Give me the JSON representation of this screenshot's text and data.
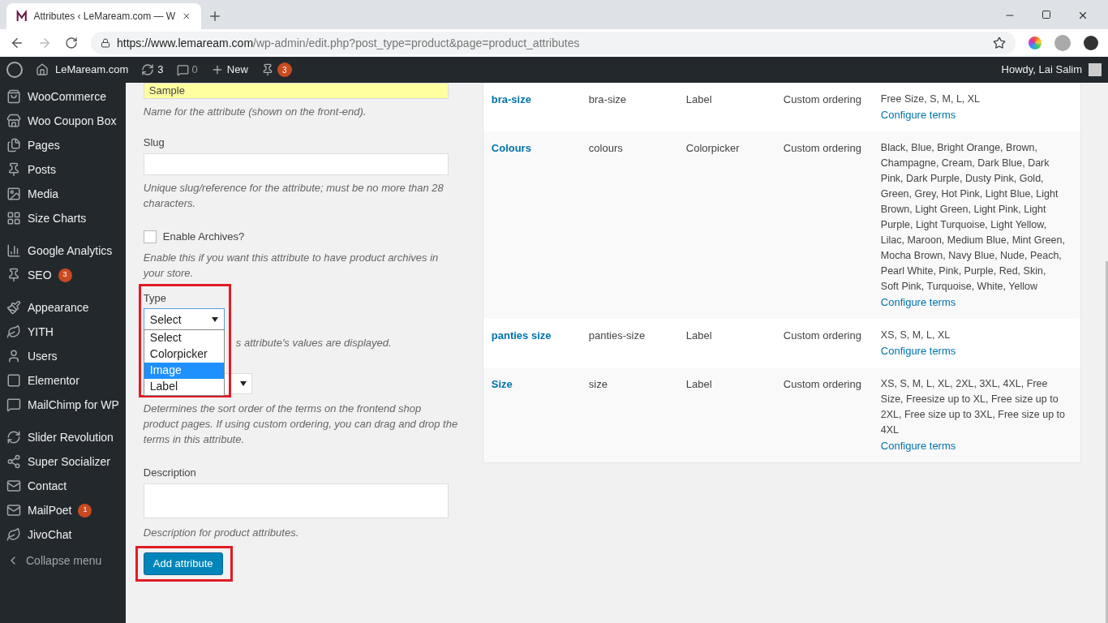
{
  "browser": {
    "tab_title": "Attributes ‹ LeMaream.com — W",
    "url_host": "https://www.lemaream.com",
    "url_path": "/wp-admin/edit.php?post_type=product&page=product_attributes"
  },
  "admin_bar": {
    "site": "LeMaream.com",
    "updates": "3",
    "comments": "0",
    "new": "New",
    "seo_badge": "3",
    "greeting": "Howdy, Lai Salim"
  },
  "sidebar": {
    "groups": [
      [
        {
          "label": "WooCommerce"
        },
        {
          "label": "Woo Coupon Box"
        },
        {
          "label": "Pages"
        },
        {
          "label": "Posts"
        },
        {
          "label": "Media"
        },
        {
          "label": "Size Charts"
        }
      ],
      [
        {
          "label": "Google Analytics"
        },
        {
          "label": "SEO",
          "badge": "3"
        }
      ],
      [
        {
          "label": "Appearance"
        },
        {
          "label": "YITH"
        },
        {
          "label": "Users"
        },
        {
          "label": "Elementor"
        },
        {
          "label": "MailChimp for WP"
        }
      ],
      [
        {
          "label": "Slider Revolution"
        },
        {
          "label": "Super Socializer"
        },
        {
          "label": "Contact"
        },
        {
          "label": "MailPoet",
          "badge": "1"
        },
        {
          "label": "JivoChat"
        }
      ]
    ],
    "collapse": "Collapse menu"
  },
  "form": {
    "name_value": "Sample",
    "name_help": "Name for the attribute (shown on the front-end).",
    "slug_label": "Slug",
    "slug_help": "Unique slug/reference for the attribute; must be no more than 28 characters.",
    "archives_label": "Enable Archives?",
    "archives_checked": false,
    "archives_help": "Enable this if you want this attribute to have product archives in your store.",
    "type_label": "Type",
    "type_value": "Select",
    "type_options": [
      {
        "label": "Select",
        "selected": false
      },
      {
        "label": "Colorpicker",
        "selected": false
      },
      {
        "label": "Image",
        "selected": true
      },
      {
        "label": "Label",
        "selected": false
      }
    ],
    "type_help_fragment": "s attribute's values are displayed.",
    "sort_help": "Determines the sort order of the terms on the frontend shop product pages. If using custom ordering, you can drag and drop the terms in this attribute.",
    "description_label": "Description",
    "description_help": "Description for product attributes.",
    "submit": "Add attribute"
  },
  "table": {
    "rows": [
      {
        "name": "bra-size",
        "slug": "bra-size",
        "type": "Label",
        "order_by": "Custom ordering",
        "terms": "Free Size, S, M, L, XL",
        "configure": "Configure terms"
      },
      {
        "name": "Colours",
        "slug": "colours",
        "type": "Colorpicker",
        "order_by": "Custom ordering",
        "terms": "Black, Blue, Bright Orange, Brown, Champagne, Cream, Dark Blue, Dark Pink, Dark Purple, Dusty Pink, Gold, Green, Grey, Hot Pink, Light Blue, Light Brown, Light Green, Light Pink, Light Purple, Light Turquoise, Light Yellow, Lilac, Maroon, Medium Blue, Mint Green, Mocha Brown, Navy Blue, Nude, Peach, Pearl White, Pink, Purple, Red, Skin, Soft Pink, Turquoise, White, Yellow",
        "configure": "Configure terms"
      },
      {
        "name": "panties size",
        "slug": "panties-size",
        "type": "Label",
        "order_by": "Custom ordering",
        "terms": "XS, S, M, L, XL",
        "configure": "Configure terms"
      },
      {
        "name": "Size",
        "slug": "size",
        "type": "Label",
        "order_by": "Custom ordering",
        "terms": "XS, S, M, L, XL, 2XL, 3XL, 4XL, Free Size, Freesize up to XL, Free size up to 2XL, Free size up to 3XL, Free size up to 4XL",
        "configure": "Configure terms"
      }
    ]
  }
}
